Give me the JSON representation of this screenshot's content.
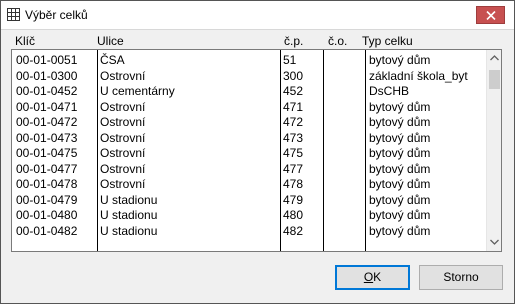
{
  "window": {
    "title": "Výběr celků"
  },
  "columns": {
    "klic": "Klíč",
    "ulice": "Ulice",
    "cp": "č.p.",
    "co": "č.o.",
    "typ": "Typ celku"
  },
  "rows": [
    {
      "klic": "00-01-0051",
      "ulice": "ČSA",
      "cp": "51",
      "co": "",
      "typ": "bytový dům"
    },
    {
      "klic": "00-01-0300",
      "ulice": "Ostrovní",
      "cp": "300",
      "co": "",
      "typ": "základní škola_byt"
    },
    {
      "klic": "00-01-0452",
      "ulice": "U cementárny",
      "cp": "452",
      "co": "",
      "typ": "DsCHB"
    },
    {
      "klic": "00-01-0471",
      "ulice": "Ostrovní",
      "cp": "471",
      "co": "",
      "typ": "bytový dům"
    },
    {
      "klic": "00-01-0472",
      "ulice": "Ostrovní",
      "cp": "472",
      "co": "",
      "typ": "bytový dům"
    },
    {
      "klic": "00-01-0473",
      "ulice": "Ostrovní",
      "cp": "473",
      "co": "",
      "typ": "bytový dům"
    },
    {
      "klic": "00-01-0475",
      "ulice": "Ostrovní",
      "cp": "475",
      "co": "",
      "typ": "bytový dům"
    },
    {
      "klic": "00-01-0477",
      "ulice": "Ostrovní",
      "cp": "477",
      "co": "",
      "typ": "bytový dům"
    },
    {
      "klic": "00-01-0478",
      "ulice": "Ostrovní",
      "cp": "478",
      "co": "",
      "typ": "bytový dům"
    },
    {
      "klic": "00-01-0479",
      "ulice": "U stadionu",
      "cp": "479",
      "co": "",
      "typ": "bytový dům"
    },
    {
      "klic": "00-01-0480",
      "ulice": "U stadionu",
      "cp": "480",
      "co": "",
      "typ": "bytový dům"
    },
    {
      "klic": "00-01-0482",
      "ulice": "U stadionu",
      "cp": "482",
      "co": "",
      "typ": "bytový dům"
    }
  ],
  "buttons": {
    "ok_label": "OK",
    "ok_rest": "K",
    "ok_mnemonic": "O",
    "cancel_label": "Storno"
  },
  "icons": {
    "app": "table-icon",
    "close": "close-icon",
    "scroll_up": "chevron-up-icon",
    "scroll_down": "chevron-down-icon"
  },
  "colors": {
    "close_button": "#c75050",
    "default_button_border": "#0078d7"
  }
}
